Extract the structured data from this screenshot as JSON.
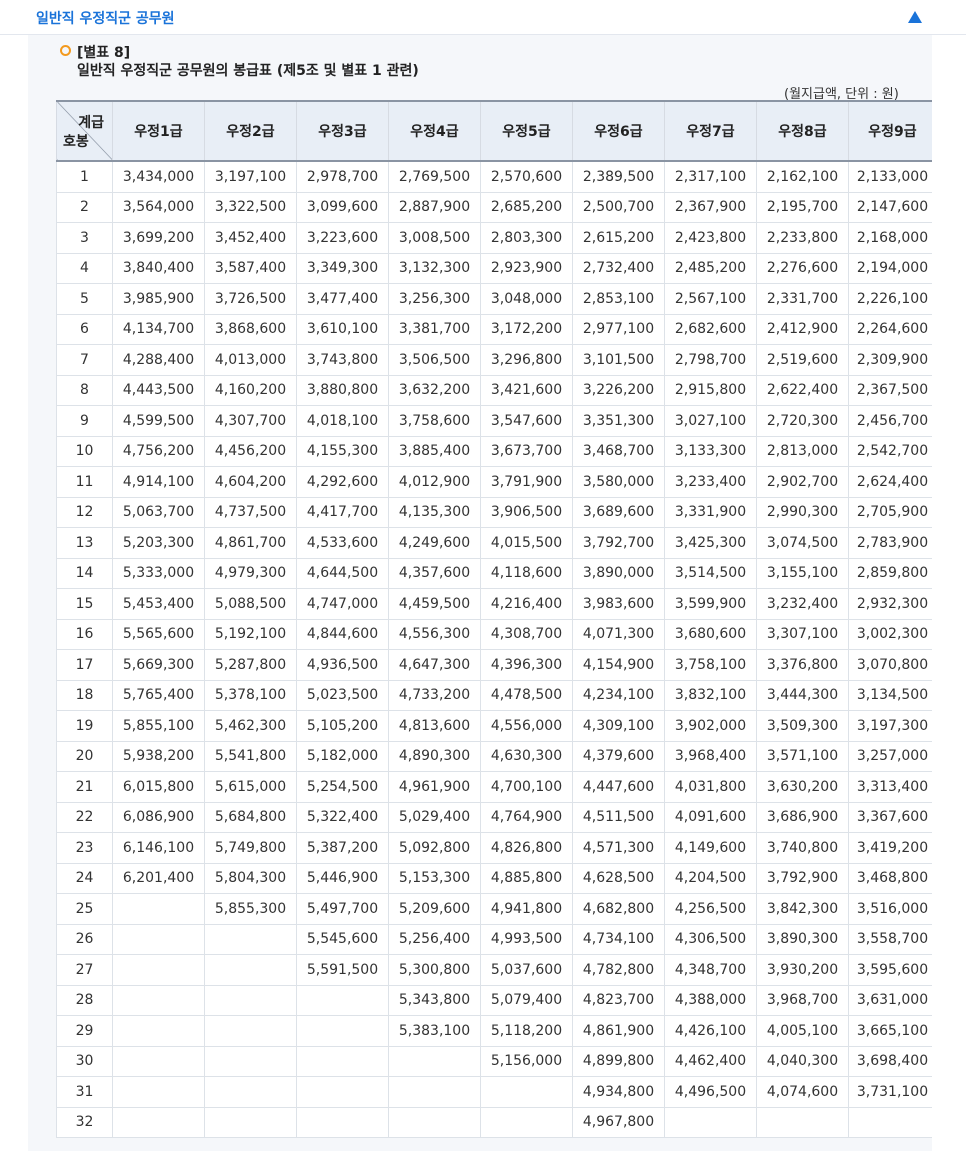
{
  "header": {
    "title": "일반직 우정직군 공무원"
  },
  "caption": {
    "label": "[별표 8]",
    "title": "일반직 우정직군 공무원의 봉급표 (제5조 및 별표 1 관련)",
    "unit": "(월지급액, 단위 : 원)"
  },
  "table": {
    "corner_top": "계급",
    "corner_bottom": "호봉",
    "columns": [
      "우정1급",
      "우정2급",
      "우정3급",
      "우정4급",
      "우정5급",
      "우정6급",
      "우정7급",
      "우정8급",
      "우정9급"
    ],
    "rows": [
      [
        "1",
        "3,434,000",
        "3,197,100",
        "2,978,700",
        "2,769,500",
        "2,570,600",
        "2,389,500",
        "2,317,100",
        "2,162,100",
        "2,133,000"
      ],
      [
        "2",
        "3,564,000",
        "3,322,500",
        "3,099,600",
        "2,887,900",
        "2,685,200",
        "2,500,700",
        "2,367,900",
        "2,195,700",
        "2,147,600"
      ],
      [
        "3",
        "3,699,200",
        "3,452,400",
        "3,223,600",
        "3,008,500",
        "2,803,300",
        "2,615,200",
        "2,423,800",
        "2,233,800",
        "2,168,000"
      ],
      [
        "4",
        "3,840,400",
        "3,587,400",
        "3,349,300",
        "3,132,300",
        "2,923,900",
        "2,732,400",
        "2,485,200",
        "2,276,600",
        "2,194,000"
      ],
      [
        "5",
        "3,985,900",
        "3,726,500",
        "3,477,400",
        "3,256,300",
        "3,048,000",
        "2,853,100",
        "2,567,100",
        "2,331,700",
        "2,226,100"
      ],
      [
        "6",
        "4,134,700",
        "3,868,600",
        "3,610,100",
        "3,381,700",
        "3,172,200",
        "2,977,100",
        "2,682,600",
        "2,412,900",
        "2,264,600"
      ],
      [
        "7",
        "4,288,400",
        "4,013,000",
        "3,743,800",
        "3,506,500",
        "3,296,800",
        "3,101,500",
        "2,798,700",
        "2,519,600",
        "2,309,900"
      ],
      [
        "8",
        "4,443,500",
        "4,160,200",
        "3,880,800",
        "3,632,200",
        "3,421,600",
        "3,226,200",
        "2,915,800",
        "2,622,400",
        "2,367,500"
      ],
      [
        "9",
        "4,599,500",
        "4,307,700",
        "4,018,100",
        "3,758,600",
        "3,547,600",
        "3,351,300",
        "3,027,100",
        "2,720,300",
        "2,456,700"
      ],
      [
        "10",
        "4,756,200",
        "4,456,200",
        "4,155,300",
        "3,885,400",
        "3,673,700",
        "3,468,700",
        "3,133,300",
        "2,813,000",
        "2,542,700"
      ],
      [
        "11",
        "4,914,100",
        "4,604,200",
        "4,292,600",
        "4,012,900",
        "3,791,900",
        "3,580,000",
        "3,233,400",
        "2,902,700",
        "2,624,400"
      ],
      [
        "12",
        "5,063,700",
        "4,737,500",
        "4,417,700",
        "4,135,300",
        "3,906,500",
        "3,689,600",
        "3,331,900",
        "2,990,300",
        "2,705,900"
      ],
      [
        "13",
        "5,203,300",
        "4,861,700",
        "4,533,600",
        "4,249,600",
        "4,015,500",
        "3,792,700",
        "3,425,300",
        "3,074,500",
        "2,783,900"
      ],
      [
        "14",
        "5,333,000",
        "4,979,300",
        "4,644,500",
        "4,357,600",
        "4,118,600",
        "3,890,000",
        "3,514,500",
        "3,155,100",
        "2,859,800"
      ],
      [
        "15",
        "5,453,400",
        "5,088,500",
        "4,747,000",
        "4,459,500",
        "4,216,400",
        "3,983,600",
        "3,599,900",
        "3,232,400",
        "2,932,300"
      ],
      [
        "16",
        "5,565,600",
        "5,192,100",
        "4,844,600",
        "4,556,300",
        "4,308,700",
        "4,071,300",
        "3,680,600",
        "3,307,100",
        "3,002,300"
      ],
      [
        "17",
        "5,669,300",
        "5,287,800",
        "4,936,500",
        "4,647,300",
        "4,396,300",
        "4,154,900",
        "3,758,100",
        "3,376,800",
        "3,070,800"
      ],
      [
        "18",
        "5,765,400",
        "5,378,100",
        "5,023,500",
        "4,733,200",
        "4,478,500",
        "4,234,100",
        "3,832,100",
        "3,444,300",
        "3,134,500"
      ],
      [
        "19",
        "5,855,100",
        "5,462,300",
        "5,105,200",
        "4,813,600",
        "4,556,000",
        "4,309,100",
        "3,902,000",
        "3,509,300",
        "3,197,300"
      ],
      [
        "20",
        "5,938,200",
        "5,541,800",
        "5,182,000",
        "4,890,300",
        "4,630,300",
        "4,379,600",
        "3,968,400",
        "3,571,100",
        "3,257,000"
      ],
      [
        "21",
        "6,015,800",
        "5,615,000",
        "5,254,500",
        "4,961,900",
        "4,700,100",
        "4,447,600",
        "4,031,800",
        "3,630,200",
        "3,313,400"
      ],
      [
        "22",
        "6,086,900",
        "5,684,800",
        "5,322,400",
        "5,029,400",
        "4,764,900",
        "4,511,500",
        "4,091,600",
        "3,686,900",
        "3,367,600"
      ],
      [
        "23",
        "6,146,100",
        "5,749,800",
        "5,387,200",
        "5,092,800",
        "4,826,800",
        "4,571,300",
        "4,149,600",
        "3,740,800",
        "3,419,200"
      ],
      [
        "24",
        "6,201,400",
        "5,804,300",
        "5,446,900",
        "5,153,300",
        "4,885,800",
        "4,628,500",
        "4,204,500",
        "3,792,900",
        "3,468,800"
      ],
      [
        "25",
        "",
        "5,855,300",
        "5,497,700",
        "5,209,600",
        "4,941,800",
        "4,682,800",
        "4,256,500",
        "3,842,300",
        "3,516,000"
      ],
      [
        "26",
        "",
        "",
        "5,545,600",
        "5,256,400",
        "4,993,500",
        "4,734,100",
        "4,306,500",
        "3,890,300",
        "3,558,700"
      ],
      [
        "27",
        "",
        "",
        "5,591,500",
        "5,300,800",
        "5,037,600",
        "4,782,800",
        "4,348,700",
        "3,930,200",
        "3,595,600"
      ],
      [
        "28",
        "",
        "",
        "",
        "5,343,800",
        "5,079,400",
        "4,823,700",
        "4,388,000",
        "3,968,700",
        "3,631,000"
      ],
      [
        "29",
        "",
        "",
        "",
        "5,383,100",
        "5,118,200",
        "4,861,900",
        "4,426,100",
        "4,005,100",
        "3,665,100"
      ],
      [
        "30",
        "",
        "",
        "",
        "",
        "5,156,000",
        "4,899,800",
        "4,462,400",
        "4,040,300",
        "3,698,400"
      ],
      [
        "31",
        "",
        "",
        "",
        "",
        "",
        "4,934,800",
        "4,496,500",
        "4,074,600",
        "3,731,100"
      ],
      [
        "32",
        "",
        "",
        "",
        "",
        "",
        "4,967,800",
        "",
        "",
        ""
      ]
    ]
  },
  "colors": {
    "accent": "#1a73d9",
    "bullet": "#f39a1e",
    "header_bg": "#e8eef6",
    "panel_bg": "#f5f7fa"
  }
}
